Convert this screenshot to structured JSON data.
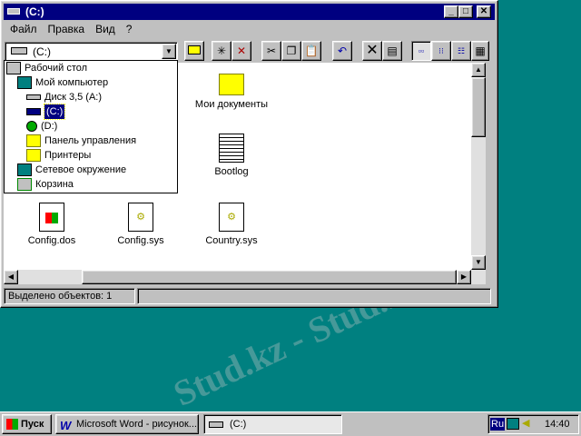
{
  "window": {
    "title": "(C:)",
    "minimize": "_",
    "maximize": "□",
    "close": "✕"
  },
  "menu": [
    {
      "label": "Файл"
    },
    {
      "label": "Правка"
    },
    {
      "label": "Вид"
    },
    {
      "label": "?"
    }
  ],
  "address": {
    "value": "(C:)"
  },
  "toolbar": [
    "up-folder",
    "map-drive",
    "disconnect-drive",
    "cut",
    "copy",
    "paste",
    "undo",
    "delete",
    "properties",
    "large-icons",
    "small-icons",
    "list",
    "details"
  ],
  "tree": [
    {
      "label": "Рабочий стол",
      "level": 0,
      "icon": "desktop-icon"
    },
    {
      "label": "Мой компьютер",
      "level": 1,
      "icon": "computer-icon"
    },
    {
      "label": "Диск 3,5 (A:)",
      "level": 2,
      "icon": "floppy-icon"
    },
    {
      "label": "(C:)",
      "level": 2,
      "icon": "harddrive-icon",
      "selected": true
    },
    {
      "label": "(D:)",
      "level": 2,
      "icon": "cdrom-icon"
    },
    {
      "label": "Панель управления",
      "level": 2,
      "icon": "control-panel-icon"
    },
    {
      "label": "Принтеры",
      "level": 2,
      "icon": "printers-icon"
    },
    {
      "label": "Сетевое окружение",
      "level": 1,
      "icon": "network-icon"
    },
    {
      "label": "Корзина",
      "level": 1,
      "icon": "recycle-bin-icon"
    }
  ],
  "files": [
    {
      "label": "Мои документы",
      "icon": "folder-icon"
    },
    {
      "label": "Bootlog",
      "icon": "text-file-icon"
    },
    {
      "label": "Config.dos",
      "icon": "windows-file-icon"
    },
    {
      "label": "Config.sys",
      "icon": "system-file-icon"
    },
    {
      "label": "Country.sys",
      "icon": "system-file-icon"
    }
  ],
  "status": {
    "text": "Выделено объектов: 1"
  },
  "taskbar": {
    "start": "Пуск",
    "tasks": [
      {
        "label": "Microsoft Word - рисунок..."
      },
      {
        "label": "(C:)"
      }
    ],
    "lang": "Ru",
    "clock": "14:40"
  },
  "watermark": "Stud.kz - Stud.kz"
}
